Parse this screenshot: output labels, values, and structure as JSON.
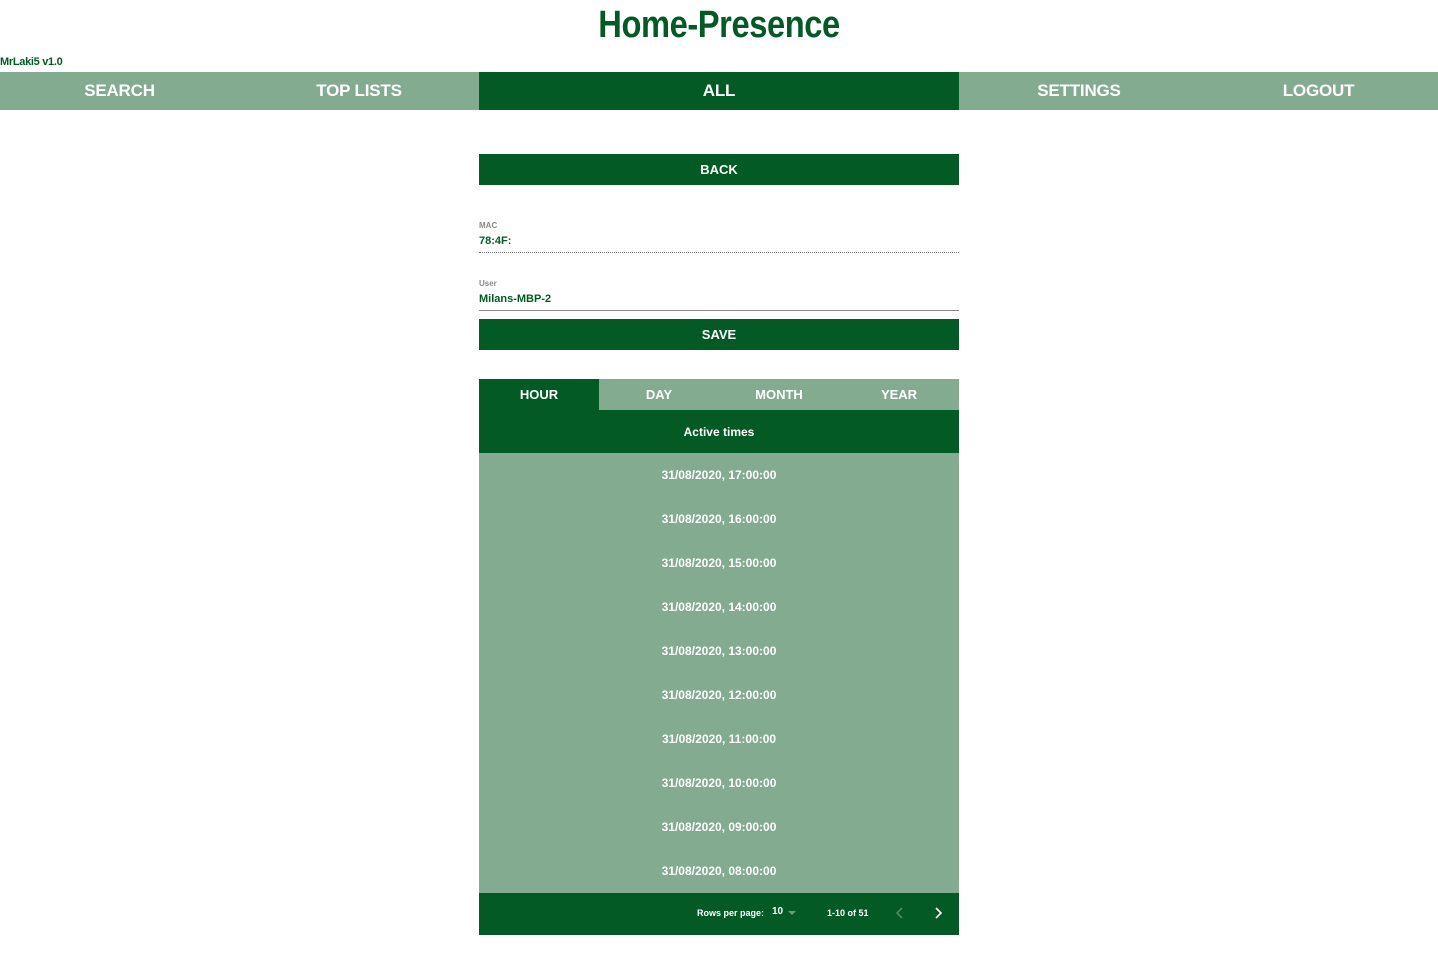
{
  "app": {
    "title": "Home-Presence",
    "version": "MrLaki5 v1.0"
  },
  "nav": {
    "items": [
      {
        "label": "SEARCH"
      },
      {
        "label": "TOP LISTS"
      },
      {
        "label": "ALL",
        "active": true
      },
      {
        "label": "SETTINGS"
      },
      {
        "label": "LOGOUT"
      }
    ]
  },
  "back_label": "BACK",
  "form": {
    "mac_label": "MAC",
    "mac_value": "78:4F:",
    "user_label": "User",
    "user_value": "Milans-MBP-2",
    "save_label": "SAVE"
  },
  "tabs": [
    {
      "label": "HOUR",
      "active": true
    },
    {
      "label": "DAY"
    },
    {
      "label": "MONTH"
    },
    {
      "label": "YEAR"
    }
  ],
  "table": {
    "header": "Active times",
    "rows": [
      "31/08/2020, 17:00:00",
      "31/08/2020, 16:00:00",
      "31/08/2020, 15:00:00",
      "31/08/2020, 14:00:00",
      "31/08/2020, 13:00:00",
      "31/08/2020, 12:00:00",
      "31/08/2020, 11:00:00",
      "31/08/2020, 10:00:00",
      "31/08/2020, 09:00:00",
      "31/08/2020, 08:00:00"
    ]
  },
  "pagination": {
    "rows_per_page_label": "Rows per page:",
    "rows_per_page_value": "10",
    "range": "1-10 of 51"
  },
  "colors": {
    "dark_green": "#035a25",
    "light_green": "#82ab90"
  }
}
